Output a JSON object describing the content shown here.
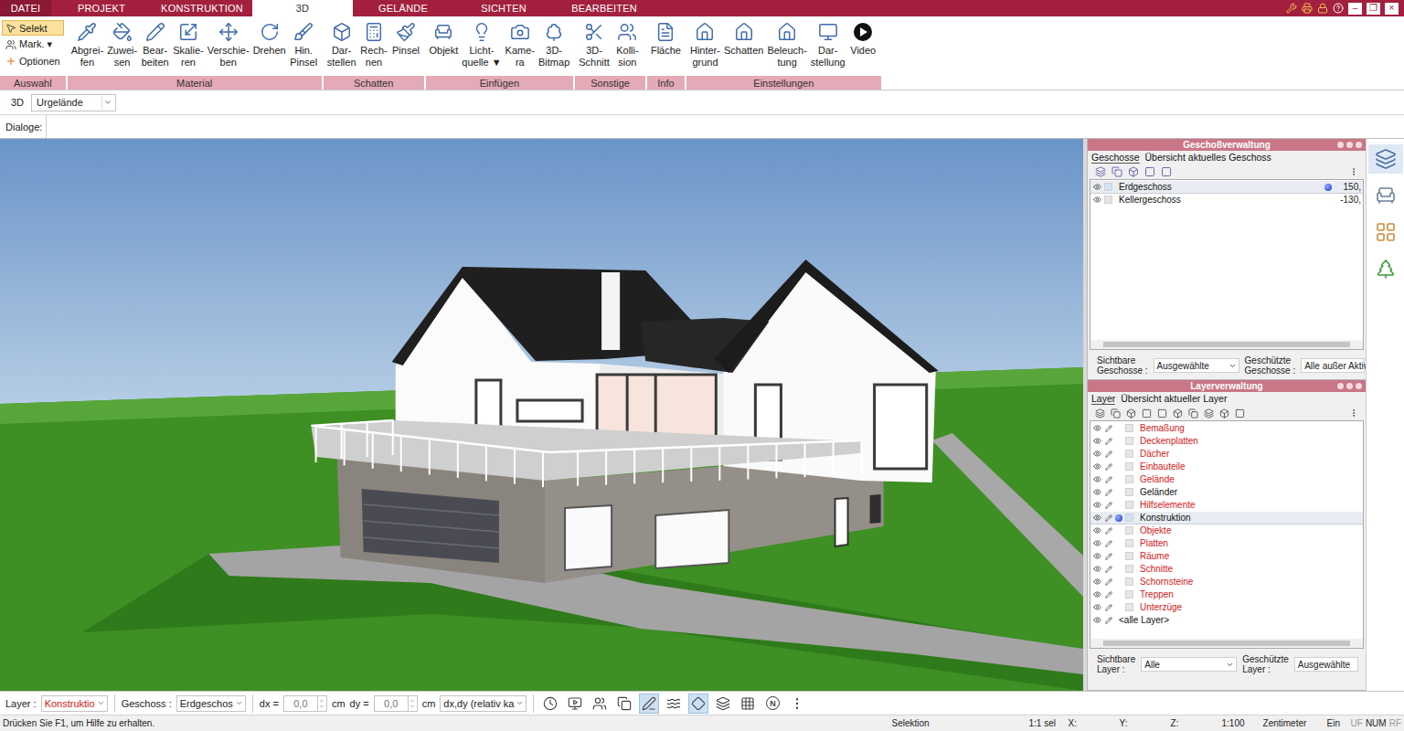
{
  "menu": {
    "tabs": [
      {
        "label": "DATEI",
        "kind": "file",
        "selected": false
      },
      {
        "label": "PROJEKT",
        "kind": "tab",
        "selected": false
      },
      {
        "label": "KONSTRUKTION",
        "kind": "tab",
        "selected": false
      },
      {
        "label": "3D",
        "kind": "tab",
        "selected": true
      },
      {
        "label": "GELÄNDE",
        "kind": "tab",
        "selected": false
      },
      {
        "label": "SICHTEN",
        "kind": "tab",
        "selected": false
      },
      {
        "label": "BEARBEITEN",
        "kind": "tab",
        "selected": false
      }
    ],
    "window_buttons": [
      "–",
      "❐",
      "×"
    ]
  },
  "ribbon": {
    "selection_group": {
      "label": "Auswahl",
      "items": [
        {
          "label": "Selekt",
          "selected": true
        },
        {
          "label": "Mark. ▾",
          "selected": false
        },
        {
          "label": "Optionen",
          "selected": false
        }
      ]
    },
    "groups": [
      {
        "label": "Material",
        "buttons": [
          {
            "lines": [
              "Abgrei-",
              "fen"
            ]
          },
          {
            "lines": [
              "Zuwei-",
              "sen"
            ]
          },
          {
            "lines": [
              "Bear-",
              "beiten"
            ]
          },
          {
            "lines": [
              "Skalie-",
              "ren"
            ]
          },
          {
            "lines": [
              "Verschie-",
              "ben"
            ]
          },
          {
            "lines": [
              "Drehen"
            ]
          },
          {
            "lines": [
              "Hin.",
              "Pinsel"
            ]
          }
        ]
      },
      {
        "label": "Schatten",
        "buttons": [
          {
            "lines": [
              "Dar-",
              "stellen"
            ]
          },
          {
            "lines": [
              "Rech-",
              "nen"
            ]
          },
          {
            "lines": [
              "Pinsel"
            ]
          }
        ]
      },
      {
        "label": "Einfügen",
        "buttons": [
          {
            "lines": [
              "Objekt"
            ]
          },
          {
            "lines": [
              "Licht-",
              "quelle ▼"
            ]
          },
          {
            "lines": [
              "Kame-",
              "ra"
            ]
          },
          {
            "lines": [
              "3D-",
              "Bitmap"
            ]
          }
        ]
      },
      {
        "label": "Sonstige",
        "buttons": [
          {
            "lines": [
              "3D-",
              "Schnitt"
            ]
          },
          {
            "lines": [
              "Kolli-",
              "sion"
            ]
          }
        ]
      },
      {
        "label": "Info",
        "buttons": [
          {
            "lines": [
              "Fläche"
            ]
          }
        ]
      },
      {
        "label": "Einstellungen",
        "buttons": [
          {
            "lines": [
              "Hinter-",
              "grund"
            ]
          },
          {
            "lines": [
              "Schatten"
            ]
          },
          {
            "lines": [
              "Beleuch-",
              "tung"
            ]
          },
          {
            "lines": [
              "Dar-",
              "stellung"
            ]
          },
          {
            "lines": [
              "Video"
            ]
          }
        ]
      }
    ]
  },
  "view_bar": {
    "label": "3D",
    "value": "Urgelände"
  },
  "dialog_bar": {
    "label": "Dialoge:"
  },
  "storey_panel": {
    "title": "Geschoßverwaltung",
    "tabs": [
      {
        "label": "Geschosse",
        "selected": true
      },
      {
        "label": "Übersicht aktuelles Geschoss",
        "selected": false
      }
    ],
    "storeys": [
      {
        "name": "Erdgeschoss",
        "height": "150,",
        "selected": true,
        "current": true
      },
      {
        "name": "Kellergeschoss",
        "height": "-130,",
        "selected": false,
        "current": false
      }
    ],
    "visible": {
      "label": [
        "Sichtbare",
        "Geschosse :"
      ],
      "value": "Ausgewählte"
    },
    "protected": {
      "label": [
        "Geschützte",
        "Geschosse :"
      ],
      "value": "Alle außer Aktive"
    }
  },
  "layer_panel": {
    "title": "Layerverwaltung",
    "tabs": [
      {
        "label": "Layer",
        "selected": true
      },
      {
        "label": "Übersicht aktueller Layer",
        "selected": false
      }
    ],
    "layers": [
      {
        "name": "Bemaßung",
        "protected": true,
        "active": false
      },
      {
        "name": "Deckenplatten",
        "protected": true,
        "active": false
      },
      {
        "name": "Dächer",
        "protected": true,
        "active": false
      },
      {
        "name": "Einbauteile",
        "protected": true,
        "active": false
      },
      {
        "name": "Gelände",
        "protected": true,
        "active": false
      },
      {
        "name": "Geländer",
        "protected": false,
        "active": false
      },
      {
        "name": "Hilfselemente",
        "protected": true,
        "active": false
      },
      {
        "name": "Konstruktion",
        "protected": false,
        "active": true
      },
      {
        "name": "Objekte",
        "protected": true,
        "active": false
      },
      {
        "name": "Platten",
        "protected": true,
        "active": false
      },
      {
        "name": "Räume",
        "protected": true,
        "active": false
      },
      {
        "name": "Schnitte",
        "protected": true,
        "active": false
      },
      {
        "name": "Schornsteine",
        "protected": true,
        "active": false
      },
      {
        "name": "Treppen",
        "protected": true,
        "active": false
      },
      {
        "name": "Unterzüge",
        "protected": true,
        "active": false
      }
    ],
    "all_layers": "<alle Layer>",
    "visible": {
      "label": [
        "Sichtbare",
        "Layer :"
      ],
      "value": "Alle"
    },
    "protected": {
      "label": [
        "Geschützte",
        "Layer :"
      ],
      "value": "Ausgewählte"
    }
  },
  "side_strip": [
    {
      "selected": true
    },
    {
      "selected": false
    },
    {
      "selected": false
    },
    {
      "selected": false
    }
  ],
  "bottom_toolbar": {
    "layer": {
      "label": "Layer :",
      "value": "Konstruktio"
    },
    "storey": {
      "label": "Geschoss :",
      "value": "Erdgeschos"
    },
    "dx": {
      "label": "dx =",
      "value": "0,0",
      "unit": "cm"
    },
    "dy": {
      "label": "dy =",
      "value": "0,0",
      "unit": "cm"
    },
    "mode": "dx,dy (relativ ka",
    "tools": [
      {
        "label": "",
        "selected": false
      },
      {
        "label": "",
        "selected": false
      },
      {
        "label": "",
        "selected": false
      },
      {
        "label": "",
        "selected": false
      },
      {
        "label": "",
        "selected": true
      },
      {
        "label": "",
        "selected": false
      },
      {
        "label": "",
        "selected": true
      },
      {
        "label": "",
        "selected": false
      },
      {
        "label": "",
        "selected": false
      },
      {
        "label": "N",
        "selected": false
      },
      {
        "label": "",
        "selected": false
      }
    ]
  },
  "status_bar": {
    "hint": "Drücken Sie F1, um Hilfe zu erhalten.",
    "fields": [
      {
        "text": "Selektion",
        "disabled": false
      },
      {
        "text": "1:1 sel",
        "disabled": false
      },
      {
        "text": "X:",
        "disabled": false
      },
      {
        "text": "Y:",
        "disabled": false
      },
      {
        "text": "Z:",
        "disabled": false
      },
      {
        "text": "1:100",
        "disabled": false
      },
      {
        "text": "Zentimeter",
        "disabled": false
      },
      {
        "text": "Ein",
        "disabled": false
      },
      {
        "text": "UF",
        "disabled": true
      },
      {
        "text": "NUM",
        "disabled": false
      },
      {
        "text": "RF",
        "disabled": true
      }
    ]
  }
}
